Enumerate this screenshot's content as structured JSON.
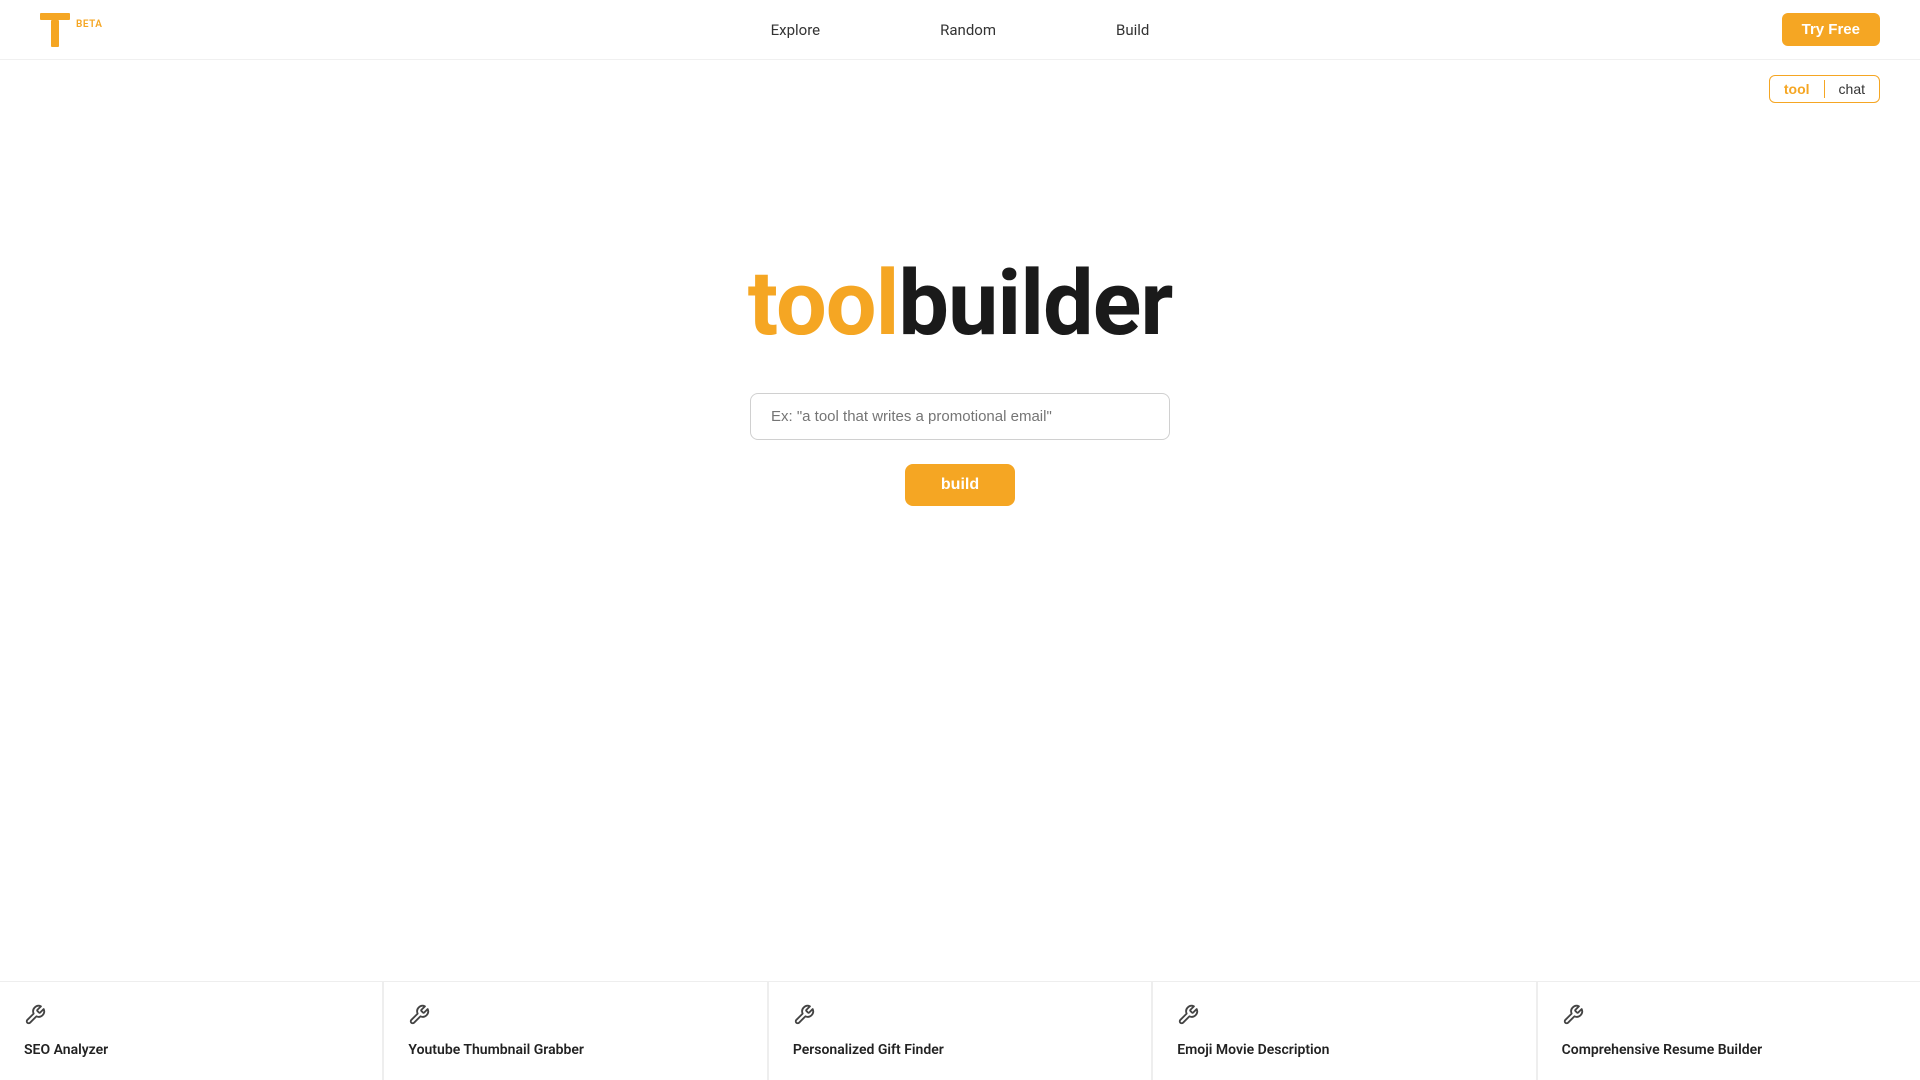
{
  "brand": {
    "beta_label": "BETA",
    "logo_color": "#f5a623"
  },
  "navbar": {
    "explore_label": "Explore",
    "random_label": "Random",
    "build_label": "Build",
    "try_free_label": "Try Free"
  },
  "mode_toggle": {
    "tool_label": "tool",
    "chat_label": "chat",
    "active": "tool"
  },
  "hero": {
    "title_tool": "tool",
    "title_builder": "builder",
    "input_placeholder": "Ex: \"a tool that writes a promotional email\"",
    "build_button_label": "build"
  },
  "tool_cards": [
    {
      "id": "seo-analyzer",
      "icon": "🔧",
      "name": "SEO Analyzer"
    },
    {
      "id": "youtube-thumbnail-grabber",
      "icon": "🔧",
      "name": "Youtube Thumbnail Grabber"
    },
    {
      "id": "personalized-gift-finder",
      "icon": "🔧",
      "name": "Personalized Gift Finder"
    },
    {
      "id": "emoji-movie-description",
      "icon": "🔧",
      "name": "Emoji Movie Description"
    },
    {
      "id": "comprehensive-resume-builder",
      "icon": "🔧",
      "name": "Comprehensive Resume Builder"
    }
  ]
}
